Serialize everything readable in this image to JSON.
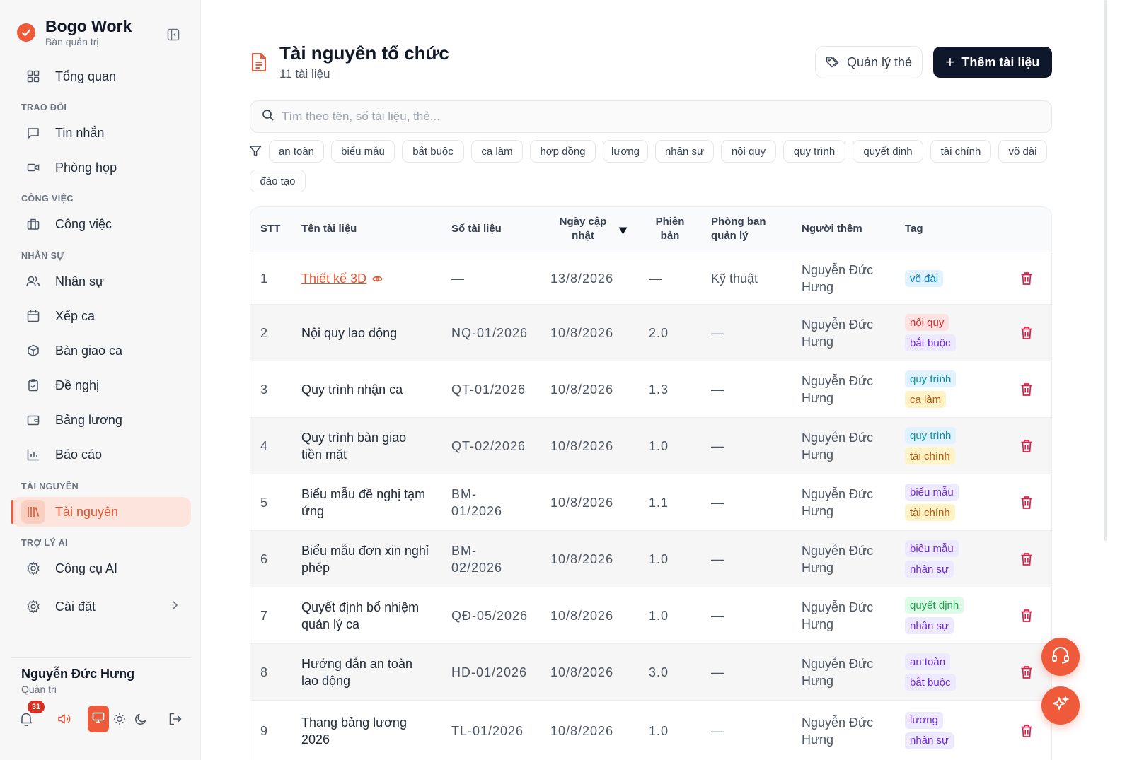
{
  "app": {
    "name": "Bogo Work",
    "subtitle": "Bàn quản trị"
  },
  "sidebar": {
    "items": [
      {
        "label": "Tổng quan"
      },
      {
        "label": "Tin nhắn"
      },
      {
        "label": "Phòng họp"
      },
      {
        "label": "Công việc"
      },
      {
        "label": "Nhân sự"
      },
      {
        "label": "Xếp ca"
      },
      {
        "label": "Bàn giao ca"
      },
      {
        "label": "Đề nghị"
      },
      {
        "label": "Bảng lương"
      },
      {
        "label": "Báo cáo"
      },
      {
        "label": "Tài nguyên"
      },
      {
        "label": "Công cụ AI"
      },
      {
        "label": "Cài đặt"
      }
    ],
    "sections": [
      "TRAO ĐỔI",
      "CÔNG VIỆC",
      "NHÂN SỰ",
      "TÀI NGUYÊN",
      "TRỢ LÝ AI"
    ],
    "active": "Tài nguyên"
  },
  "user": {
    "name": "Nguyễn Đức Hưng",
    "role": "Quản trị",
    "notifications": "31"
  },
  "page": {
    "title": "Tài nguyên tổ chức",
    "subtitle": "11 tài liệu"
  },
  "buttons": {
    "manage_tags": "Quản lý thẻ",
    "add_doc": "Thêm tài liệu"
  },
  "search": {
    "placeholder": "Tìm theo tên, số tài liệu, thẻ..."
  },
  "filter_tags": [
    "an toàn",
    "biểu mẫu",
    "bắt buộc",
    "ca làm",
    "hợp đồng",
    "lương",
    "nhân sự",
    "nội quy",
    "quy trình",
    "quyết định",
    "tài chính",
    "võ đài",
    "đào tạo"
  ],
  "table": {
    "headers": {
      "stt": "STT",
      "name": "Tên tài liệu",
      "number": "Số tài liệu",
      "updated_1": "Ngày cập",
      "updated_2": "nhật",
      "version_1": "Phiên",
      "version_2": "bản",
      "dept_1": "Phòng ban",
      "dept_2": "quản lý",
      "added_by": "Người thêm",
      "tag": "Tag"
    },
    "rows": [
      {
        "stt": "1",
        "name1": "Thiết kế 3D",
        "name2": "",
        "num1": "—",
        "num2": "",
        "date": "13/8/2026",
        "version": "—",
        "dept": "Kỹ thuật",
        "by1": "Nguyễn Đức",
        "by2": "Hưng",
        "tags": [
          "võ đài"
        ]
      },
      {
        "stt": "2",
        "name1": "Nội quy lao động",
        "name2": "",
        "num1": "NQ-01/2026",
        "num2": "",
        "date": "10/8/2026",
        "version": "2.0",
        "dept": "—",
        "by1": "Nguyễn Đức",
        "by2": "Hưng",
        "tags": [
          "nội quy",
          "bắt buộc"
        ]
      },
      {
        "stt": "3",
        "name1": "Quy trình nhận ca",
        "name2": "",
        "num1": "QT-01/2026",
        "num2": "",
        "date": "10/8/2026",
        "version": "1.3",
        "dept": "—",
        "by1": "Nguyễn Đức",
        "by2": "Hưng",
        "tags": [
          "quy trình",
          "ca làm"
        ]
      },
      {
        "stt": "4",
        "name1": "Quy trình bàn giao",
        "name2": "tiền mặt",
        "num1": "QT-02/2026",
        "num2": "",
        "date": "10/8/2026",
        "version": "1.0",
        "dept": "—",
        "by1": "Nguyễn Đức",
        "by2": "Hưng",
        "tags": [
          "quy trình",
          "tài chính"
        ]
      },
      {
        "stt": "5",
        "name1": "Biểu mẫu đề nghị tạm",
        "name2": "ứng",
        "num1": "BM-",
        "num2": "01/2026",
        "date": "10/8/2026",
        "version": "1.1",
        "dept": "—",
        "by1": "Nguyễn Đức",
        "by2": "Hưng",
        "tags": [
          "biểu mẫu",
          "tài chính"
        ]
      },
      {
        "stt": "6",
        "name1": "Biểu mẫu đơn xin nghỉ",
        "name2": "phép",
        "num1": "BM-",
        "num2": "02/2026",
        "date": "10/8/2026",
        "version": "1.0",
        "dept": "—",
        "by1": "Nguyễn Đức",
        "by2": "Hưng",
        "tags": [
          "biểu mẫu",
          "nhân sự"
        ]
      },
      {
        "stt": "7",
        "name1": "Quyết định bổ nhiệm",
        "name2": "quản lý ca",
        "num1": "QĐ-05/2026",
        "num2": "",
        "date": "10/8/2026",
        "version": "1.0",
        "dept": "—",
        "by1": "Nguyễn Đức",
        "by2": "Hưng",
        "tags": [
          "quyết định",
          "nhân sự"
        ]
      },
      {
        "stt": "8",
        "name1": "Hướng dẫn an toàn",
        "name2": "lao động",
        "num1": "HD-01/2026",
        "num2": "",
        "date": "10/8/2026",
        "version": "3.0",
        "dept": "—",
        "by1": "Nguyễn Đức",
        "by2": "Hưng",
        "tags": [
          "an toàn",
          "bắt buộc"
        ]
      },
      {
        "stt": "9",
        "name1": "Thang bảng lương",
        "name2": "2026",
        "num1": "TL-01/2026",
        "num2": "",
        "date": "10/8/2026",
        "version": "1.0",
        "dept": "—",
        "by1": "Nguyễn Đức",
        "by2": "Hưng",
        "tags": [
          "lương",
          "nhân sự"
        ]
      }
    ]
  },
  "tag_colors": {
    "võ đài": {
      "bg": "#e0f2fe",
      "fg": "#0284c7"
    },
    "nội quy": {
      "bg": "#fee2e2",
      "fg": "#dc2626"
    },
    "bắt buộc": {
      "bg": "#ede9fe",
      "fg": "#6d28d9"
    },
    "quy trình": {
      "bg": "#e0f2fe",
      "fg": "#0891b2"
    },
    "ca làm": {
      "bg": "#fef3c7",
      "fg": "#b45309"
    },
    "tài chính": {
      "bg": "#fef3c7",
      "fg": "#b45309"
    },
    "biểu mẫu": {
      "bg": "#ede9fe",
      "fg": "#6d28d9"
    },
    "nhân sự": {
      "bg": "#ede9fe",
      "fg": "#6d28d9"
    },
    "quyết định": {
      "bg": "#dcfce7",
      "fg": "#16a34a"
    },
    "an toàn": {
      "bg": "#ede9fe",
      "fg": "#6d28d9"
    },
    "lương": {
      "bg": "#ede9fe",
      "fg": "#6d28d9"
    }
  },
  "colors": {
    "accent": "#ef5a3a",
    "dark": "#0f172a",
    "danger": "#e11d48"
  }
}
